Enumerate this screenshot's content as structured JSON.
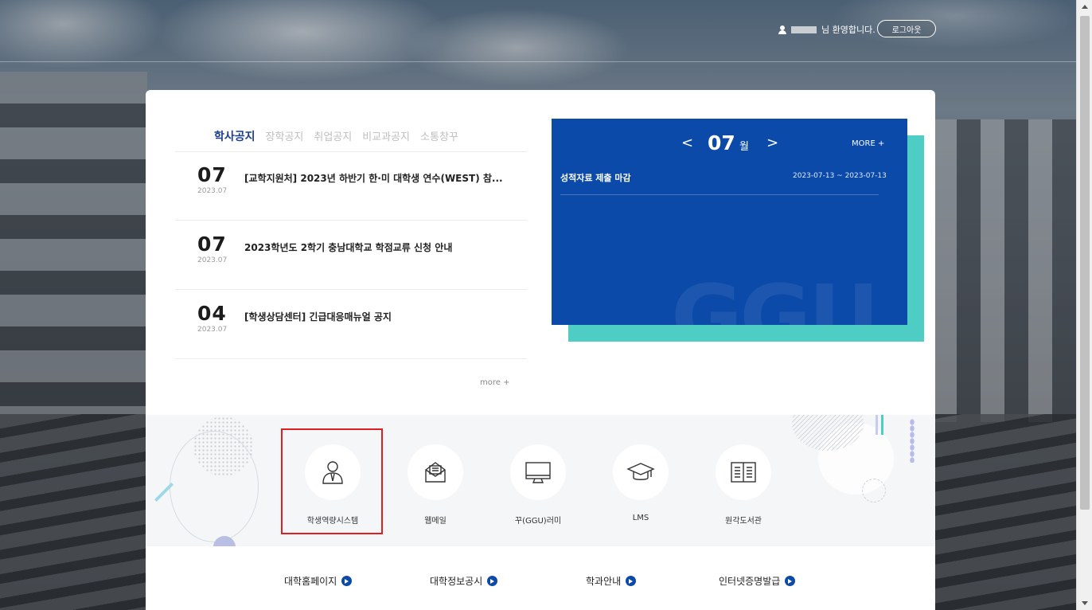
{
  "header": {
    "welcome_suffix": "님 환영합니다.",
    "logout_label": "로그아웃"
  },
  "notices": {
    "tabs": [
      "학사공지",
      "장학공지",
      "취업공지",
      "비교과공지",
      "소통창꾸"
    ],
    "active_tab": "학사공지",
    "items": [
      {
        "day": "07",
        "ym": "2023.07",
        "title": "[교학지원처] 2023년 하반기 한·미 대학생 연수(WEST) 참..."
      },
      {
        "day": "07",
        "ym": "2023.07",
        "title": "2023학년도 2학기 충남대학교 학점교류 신청 안내"
      },
      {
        "day": "04",
        "ym": "2023.07",
        "title": "[학생상담센터] 긴급대응매뉴얼 공지"
      }
    ],
    "more_label": "more +"
  },
  "calendar": {
    "prev_label": "<",
    "next_label": ">",
    "month": "07",
    "month_unit": "월",
    "more_label": "MORE +",
    "events": [
      {
        "title": "성적자료 제출 마감",
        "date": "2023-07-13 ~ 2023-07-13"
      }
    ],
    "watermark": "GGU",
    "colors": {
      "panel": "#0b4aa8",
      "accent": "#4ecdc4"
    }
  },
  "quick_links": [
    {
      "label": "학생역량시스템",
      "icon": "person-tie-icon",
      "highlighted": true
    },
    {
      "label": "웹메일",
      "icon": "envelope-letter-icon"
    },
    {
      "label": "꾸(GGU)러미",
      "icon": "monitor-icon"
    },
    {
      "label": "LMS",
      "icon": "graduation-cap-icon"
    },
    {
      "label": "원각도서관",
      "icon": "open-book-icon"
    }
  ],
  "footer_links": [
    {
      "label": "대학홈페이지"
    },
    {
      "label": "대학정보공시"
    },
    {
      "label": "학과안내"
    },
    {
      "label": "인터넷증명발급"
    }
  ],
  "theme": {
    "brand_blue": "#1a3d8f",
    "highlight_red": "#e02020"
  }
}
